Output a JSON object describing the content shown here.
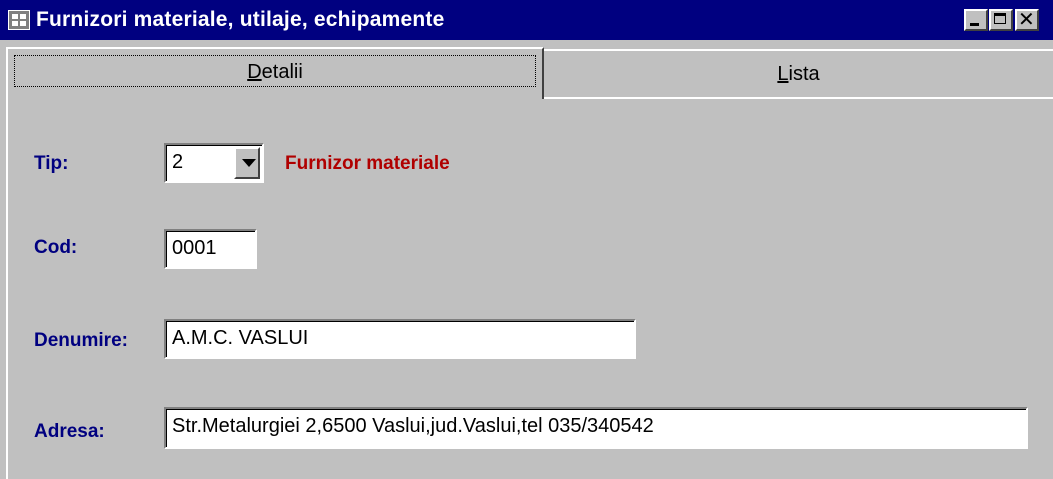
{
  "window": {
    "title": "Furnizori materiale, utilaje, echipamente"
  },
  "tabs": [
    {
      "hotkey": "D",
      "rest": "etalii"
    },
    {
      "hotkey": "L",
      "rest": "ista"
    }
  ],
  "form": {
    "tip": {
      "label": "Tip:",
      "value": "2",
      "description": "Furnizor materiale"
    },
    "cod": {
      "label": "Cod:",
      "value": "0001"
    },
    "denumire": {
      "label": "Denumire:",
      "value": "A.M.C. VASLUI"
    },
    "adresa": {
      "label": "Adresa:",
      "value": "Str.Metalurgiei 2,6500 Vaslui,jud.Vaslui,tel 035/340542"
    }
  },
  "colors": {
    "titlebar": "#000080",
    "label": "#000080",
    "description": "#b00000",
    "face": "#c0c0c0"
  }
}
